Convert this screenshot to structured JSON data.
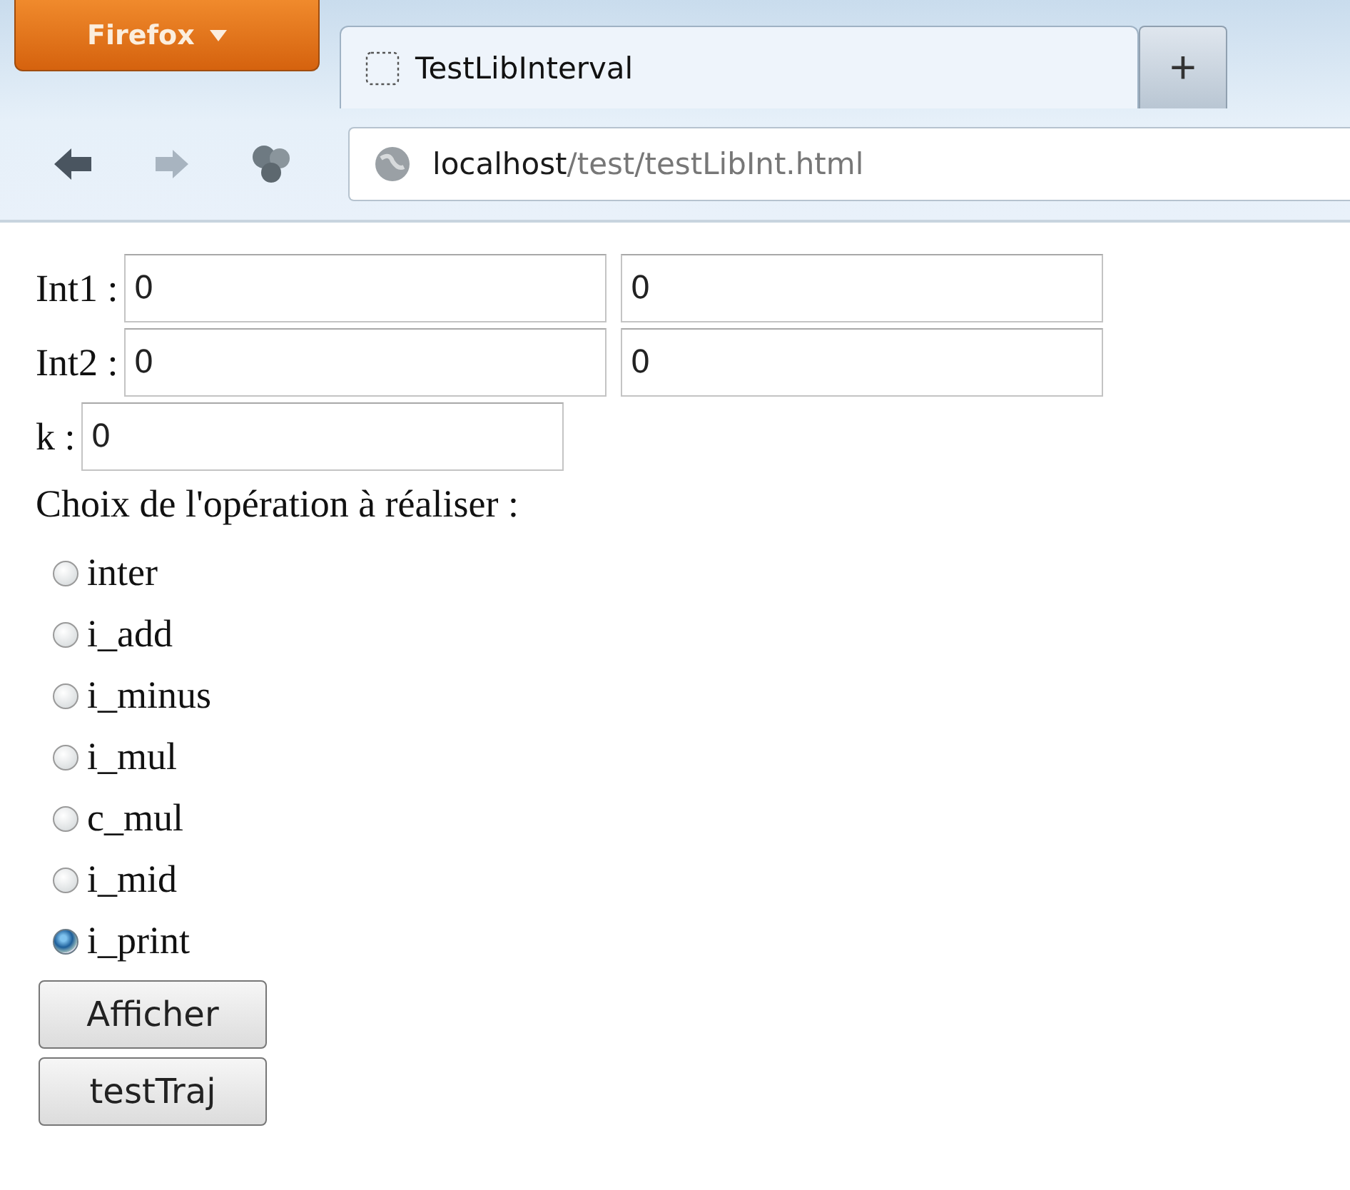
{
  "browser": {
    "menu_button": "Firefox",
    "tabs": [
      {
        "label": "TestLibInterval",
        "selected": true
      }
    ],
    "new_tab": "+",
    "url_host": "localhost",
    "url_path": "/test/testLibInt.html"
  },
  "form": {
    "rows": [
      {
        "label": "Int1 :",
        "fields": [
          "0",
          "0"
        ]
      },
      {
        "label": "Int2 :",
        "fields": [
          "0",
          "0"
        ]
      },
      {
        "label": "k :",
        "fields": [
          "0"
        ]
      }
    ],
    "prompt": "Choix de l'opération à réaliser :",
    "options": [
      {
        "label": "inter",
        "selected": false
      },
      {
        "label": "i_add",
        "selected": false
      },
      {
        "label": "i_minus",
        "selected": false
      },
      {
        "label": "i_mul",
        "selected": false
      },
      {
        "label": "c_mul",
        "selected": false
      },
      {
        "label": "i_mid",
        "selected": false
      },
      {
        "label": "i_print",
        "selected": true
      }
    ],
    "buttons": [
      "Afficher",
      "testTraj"
    ]
  }
}
